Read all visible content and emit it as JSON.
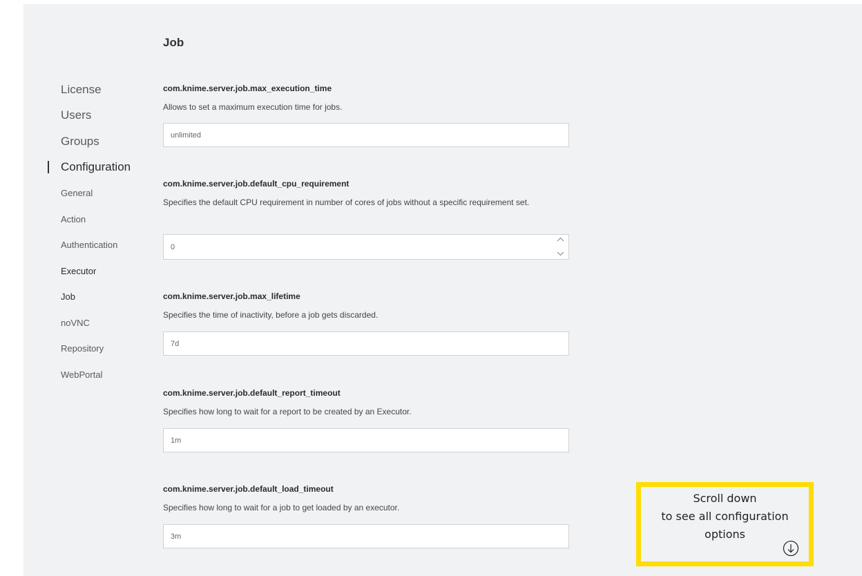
{
  "page": {
    "title": "Job"
  },
  "sidebar": {
    "top_items": [
      {
        "label": "License"
      },
      {
        "label": "Users"
      },
      {
        "label": "Groups"
      },
      {
        "label": "Configuration",
        "active": true
      }
    ],
    "sub_items": [
      {
        "label": "General"
      },
      {
        "label": "Action"
      },
      {
        "label": "Authentication"
      },
      {
        "label": "Executor"
      },
      {
        "label": "Job",
        "current": true
      },
      {
        "label": "noVNC"
      },
      {
        "label": "Repository"
      },
      {
        "label": "WebPortal"
      }
    ]
  },
  "fields": [
    {
      "name": "com.knime.server.job.max_execution_time",
      "description": "Allows to set a maximum execution time for jobs.",
      "value": "unlimited"
    },
    {
      "name": "com.knime.server.job.default_cpu_requirement",
      "description": "Specifies the default CPU requirement in number of cores of jobs without a specific requirement set.",
      "value": "0",
      "type": "number"
    },
    {
      "name": "com.knime.server.job.max_lifetime",
      "description": "Specifies the time of inactivity, before a job gets discarded.",
      "value": "7d"
    },
    {
      "name": "com.knime.server.job.default_report_timeout",
      "description": "Specifies how long to wait for a report to be created by an Executor.",
      "value": "1m"
    },
    {
      "name": "com.knime.server.job.default_load_timeout",
      "description": "Specifies how long to wait for a job to get loaded by an executor.",
      "value": "3m"
    }
  ],
  "callout": {
    "line1": "Scroll down",
    "line2": "to see all configuration",
    "line3": "options",
    "icon": "arrow-down-circle-icon",
    "border_color": "#ffdd00"
  }
}
